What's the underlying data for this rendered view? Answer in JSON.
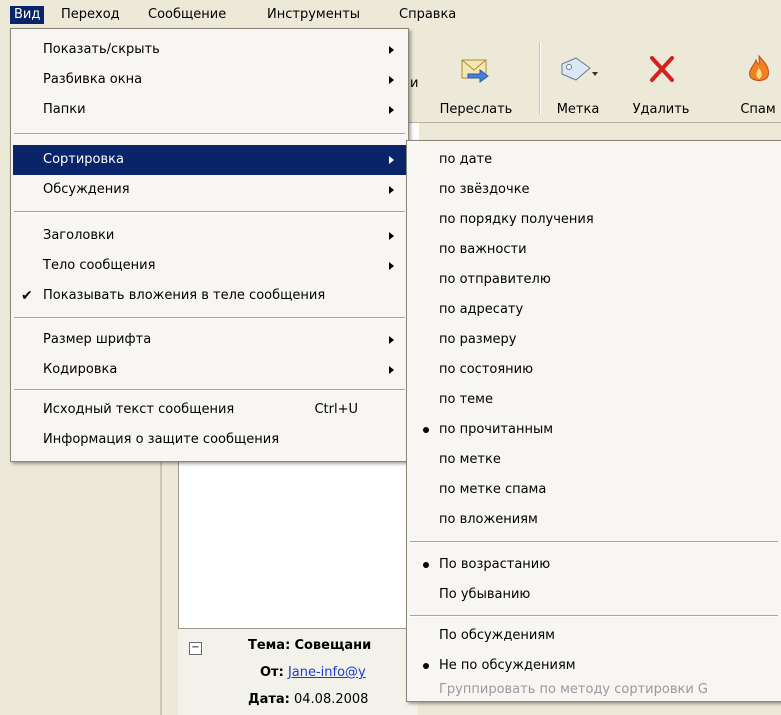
{
  "menubar": {
    "items": [
      "Вид",
      "Переход",
      "Сообщение",
      "Инструменты",
      "Справка"
    ]
  },
  "toolbar": {
    "partial_label": "и",
    "buttons": [
      {
        "label": "Переслать",
        "icon": "forward-icon"
      },
      {
        "label": "Метка",
        "icon": "tag-icon"
      },
      {
        "label": "Удалить",
        "icon": "delete-icon"
      },
      {
        "label": "Спам",
        "icon": "spam-icon"
      }
    ]
  },
  "view_menu": {
    "items": [
      {
        "label": "Показать/скрыть",
        "submenu": true
      },
      {
        "label": "Разбивка окна",
        "submenu": true
      },
      {
        "label": "Папки",
        "submenu": true
      },
      {
        "label": "Сортировка",
        "submenu": true,
        "highlighted": true
      },
      {
        "label": "Обсуждения",
        "submenu": true
      },
      {
        "label": "Заголовки",
        "submenu": true
      },
      {
        "label": "Тело сообщения",
        "submenu": true
      },
      {
        "label": "Показывать вложения в теле сообщения",
        "checked": true
      },
      {
        "label": "Размер шрифта",
        "submenu": true
      },
      {
        "label": "Кодировка",
        "submenu": true
      },
      {
        "label": "Исходный текст сообщения",
        "shortcut": "Ctrl+U"
      },
      {
        "label": "Информация о защите сообщения"
      }
    ]
  },
  "sort_menu": {
    "items": [
      {
        "label": "по дате"
      },
      {
        "label": "по звёздочке"
      },
      {
        "label": "по порядку получения"
      },
      {
        "label": "по важности"
      },
      {
        "label": "по отправителю"
      },
      {
        "label": "по адресату"
      },
      {
        "label": "по размеру"
      },
      {
        "label": "по состоянию"
      },
      {
        "label": "по теме"
      },
      {
        "label": "по прочитанным",
        "selected": true
      },
      {
        "label": "по метке"
      },
      {
        "label": "по метке спама"
      },
      {
        "label": "по вложениям"
      },
      {
        "label": "По возрастанию",
        "selected": true
      },
      {
        "label": "По убыванию"
      },
      {
        "label": "По обсуждениям"
      },
      {
        "label": "Не по обсуждениям",
        "selected": true
      },
      {
        "label": "Группировать по методу сортировки G",
        "disabled": true
      }
    ]
  },
  "message_header": {
    "subject_label": "Тема:",
    "subject_value": "Совещани",
    "from_label": "От:",
    "from_value": "Jane-info@y",
    "date_label": "Дата:",
    "date_value": "04.08.2008"
  }
}
